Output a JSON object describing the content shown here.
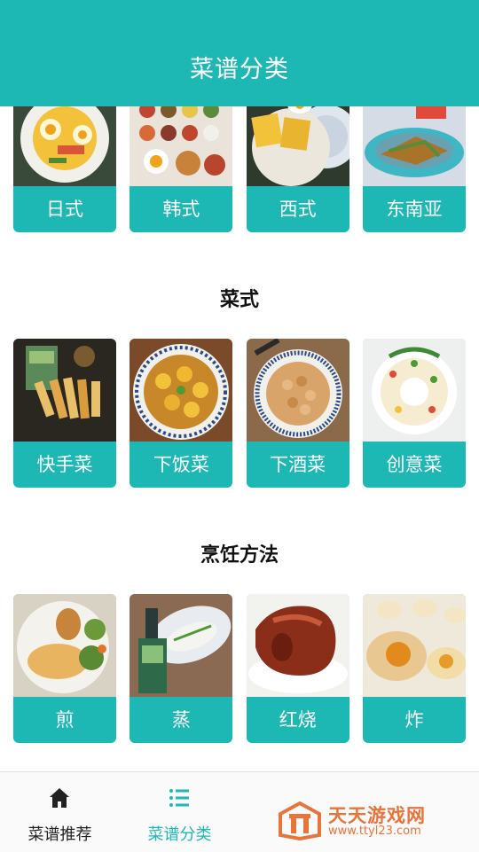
{
  "header": {
    "title": "菜谱分类"
  },
  "colors": {
    "brand": "#1db7b4",
    "tab_active": "#1db7b4",
    "tab_inactive": "#222222",
    "watermark": "#e8743a"
  },
  "sections": [
    {
      "title": "",
      "items": [
        {
          "label": "日式",
          "image": "japanese-dish-image"
        },
        {
          "label": "韩式",
          "image": "korean-dish-image"
        },
        {
          "label": "西式",
          "image": "western-dish-image"
        },
        {
          "label": "东南亚",
          "image": "southeast-asian-dish-image"
        }
      ]
    },
    {
      "title": "菜式",
      "items": [
        {
          "label": "快手菜",
          "image": "quick-dish-image"
        },
        {
          "label": "下饭菜",
          "image": "rice-dish-image"
        },
        {
          "label": "下酒菜",
          "image": "bar-snack-image"
        },
        {
          "label": "创意菜",
          "image": "creative-dish-image"
        }
      ]
    },
    {
      "title": "烹饪方法",
      "items": [
        {
          "label": "煎",
          "image": "pan-fried-image"
        },
        {
          "label": "蒸",
          "image": "steamed-image"
        },
        {
          "label": "红烧",
          "image": "braised-image"
        },
        {
          "label": "炸",
          "image": "deep-fried-image"
        }
      ]
    }
  ],
  "tabbar": {
    "tabs": [
      {
        "label": "菜谱推荐",
        "icon": "home-icon",
        "active": false
      },
      {
        "label": "菜谱分类",
        "icon": "list-icon",
        "active": true
      }
    ]
  },
  "watermark": {
    "title": "天天游戏网",
    "url": "www.ttyl23.com"
  }
}
